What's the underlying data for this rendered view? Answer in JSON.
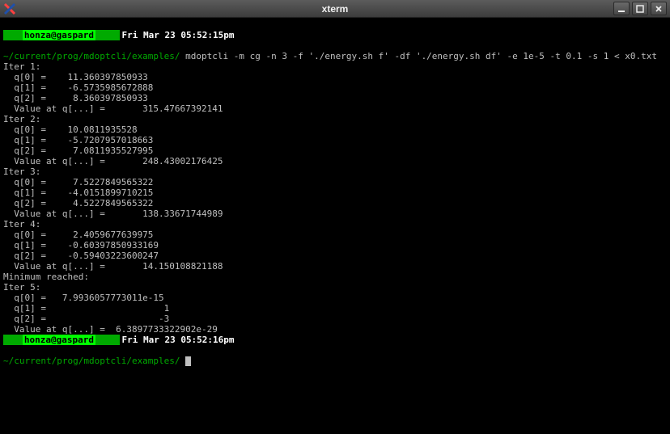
{
  "window": {
    "title": "xterm"
  },
  "status1": {
    "user": "honza@gaspard",
    "timestamp": "Fri Mar 23 05:52:15pm"
  },
  "prompt1": {
    "path": "~/current/prog/mdoptcli/examples/",
    "command": "mdoptcli -m cg -n 3 -f './energy.sh f' -df './energy.sh df' -e 1e-5 -t 0.1 -s 1 < x0.txt"
  },
  "iters": [
    {
      "label": "Iter 1:",
      "q": [
        "  q[0] =    11.360397850933",
        "  q[1] =    -6.5735985672888",
        "  q[2] =     8.360397850933"
      ],
      "val": "  Value at q[...] =       315.47667392141"
    },
    {
      "label": "Iter 2:",
      "q": [
        "  q[0] =    10.0811935528",
        "  q[1] =    -5.7207957018663",
        "  q[2] =     7.0811935527995"
      ],
      "val": "  Value at q[...] =       248.43002176425"
    },
    {
      "label": "Iter 3:",
      "q": [
        "  q[0] =     7.5227849565322",
        "  q[1] =    -4.0151899710215",
        "  q[2] =     4.5227849565322"
      ],
      "val": "  Value at q[...] =       138.33671744989"
    },
    {
      "label": "Iter 4:",
      "q": [
        "  q[0] =     2.4059677639975",
        "  q[1] =    -0.60397850933169",
        "  q[2] =    -0.59403223600247"
      ],
      "val": "  Value at q[...] =       14.150108821188"
    }
  ],
  "minreached": "Minimum reached:",
  "iter5": {
    "label": "Iter 5:",
    "q": [
      "  q[0] =   7.9936057773011e-15",
      "  q[1] =                      1",
      "  q[2] =                     -3"
    ],
    "val": "  Value at q[...] =  6.3897733322902e-29"
  },
  "status2": {
    "user": "honza@gaspard",
    "timestamp": "Fri Mar 23 05:52:16pm"
  },
  "prompt2": {
    "path": "~/current/prog/mdoptcli/examples/"
  }
}
